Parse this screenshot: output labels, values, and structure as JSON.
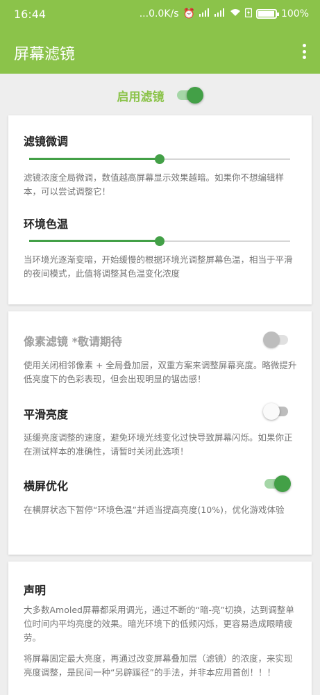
{
  "status_bar": {
    "time": "16:44",
    "network_speed": "...0.0K/s",
    "battery": "100%",
    "icons": [
      "alarm-icon",
      "signal-icon",
      "signal-hd-icon",
      "wifi-icon",
      "battery-saver-icon",
      "battery-icon"
    ]
  },
  "app_bar": {
    "title": "屏幕滤镜",
    "menu_icon": "more-vert-icon"
  },
  "enable": {
    "label": "启用滤镜",
    "on": true
  },
  "card1": {
    "fine_tune": {
      "title": "滤镜微调",
      "value": 0.5,
      "desc": "滤镜浓度全局微调，数值越高屏幕显示效果越暗。如果你不想编辑样本，可以尝试调整它！"
    },
    "color_temp": {
      "title": "环境色温",
      "value": 0.5,
      "desc": "当环境光逐渐变暗，开始缓慢的根据环境光调整屏幕色温，相当于平滑的夜间模式，此值将调整其色温变化浓度"
    }
  },
  "card2": {
    "pixel_filter": {
      "title": "像素滤镜 *敬请期待",
      "enabled": false,
      "on": false,
      "desc": "使用关闭相邻像素 + 全局叠加层，双重方案来调整屏幕亮度。略微提升低亮度下的色彩表现，但会出现明显的锯齿感！"
    },
    "smooth_brightness": {
      "title": "平滑亮度",
      "on": false,
      "desc": "延缓亮度调整的速度，避免环境光线变化过快导致屏幕闪烁。如果你正在测试样本的准确性，请暂时关闭此选项！"
    },
    "landscape": {
      "title": "横屏优化",
      "on": true,
      "desc": "在横屏状态下暂停“环境色温”并适当提高亮度(10%)，优化游戏体验"
    }
  },
  "card3": {
    "title": "声明",
    "para1": "大多数Amoled屏幕都采用调光，通过不断的“暗-亮”切换，达到调整单位时间内平均亮度的效果。暗光环境下的低频闪烁，更容易造成眼睛疲劳。",
    "para2": "将屏幕固定最大亮度，再通过改变屏幕叠加层（滤镜）的浓度，来实现亮度调整，是民间一种“另辟蹊径”的手法，并非本应用首创！！！"
  },
  "colors": {
    "app_bar": "#8bc34a",
    "accent": "#43a047",
    "background": "#eeeeee"
  }
}
